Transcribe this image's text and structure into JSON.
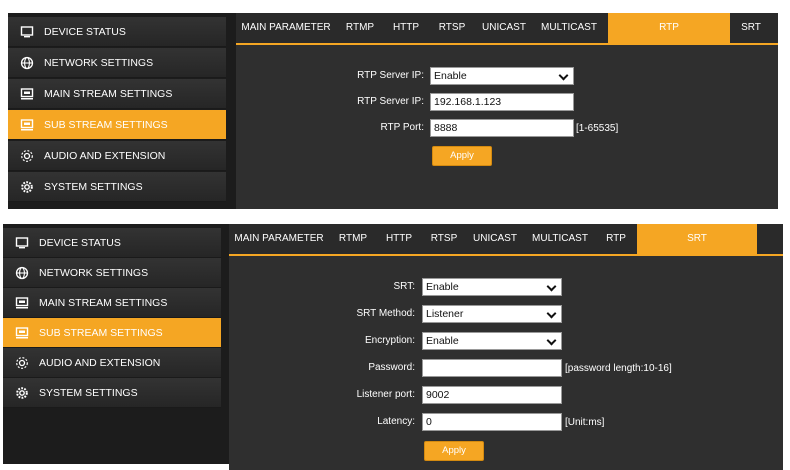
{
  "sidebar": {
    "items": [
      {
        "label": "DEVICE STATUS",
        "icon": "monitor-icon"
      },
      {
        "label": "NETWORK SETTINGS",
        "icon": "globe-icon"
      },
      {
        "label": "MAIN STREAM SETTINGS",
        "icon": "stream-icon"
      },
      {
        "label": "SUB STREAM SETTINGS",
        "icon": "stream-icon",
        "active": true
      },
      {
        "label": "AUDIO AND EXTENSION",
        "icon": "audio-icon"
      },
      {
        "label": "SYSTEM SETTINGS",
        "icon": "gear-icon"
      }
    ]
  },
  "tabs": [
    "MAIN PARAMETER",
    "RTMP",
    "HTTP",
    "RTSP",
    "UNICAST",
    "MULTICAST",
    "RTP",
    "SRT"
  ],
  "rtp_panel": {
    "active_tab": "RTP",
    "server_ip_select_label": "RTP Server IP:",
    "server_ip_select_value": "Enable",
    "server_ip_label": "RTP Server IP:",
    "server_ip_value": "192.168.1.123",
    "port_label": "RTP Port:",
    "port_value": "8888",
    "port_hint": "[1-65535]",
    "apply_label": "Apply"
  },
  "srt_panel": {
    "active_tab": "SRT",
    "srt_label": "SRT:",
    "srt_value": "Enable",
    "method_label": "SRT Method:",
    "method_value": "Listener",
    "encryption_label": "Encryption:",
    "encryption_value": "Enable",
    "password_label": "Password:",
    "password_value": "",
    "password_hint": "[password length:10-16]",
    "listener_port_label": "Listener port:",
    "listener_port_value": "9002",
    "latency_label": "Latency:",
    "latency_value": "0",
    "latency_hint": "[Unit:ms]",
    "apply_label": "Apply"
  },
  "colors": {
    "accent": "#f5a623",
    "panel_bg": "#2f2f2f",
    "sidebar_bg": "#2a2a2a"
  }
}
